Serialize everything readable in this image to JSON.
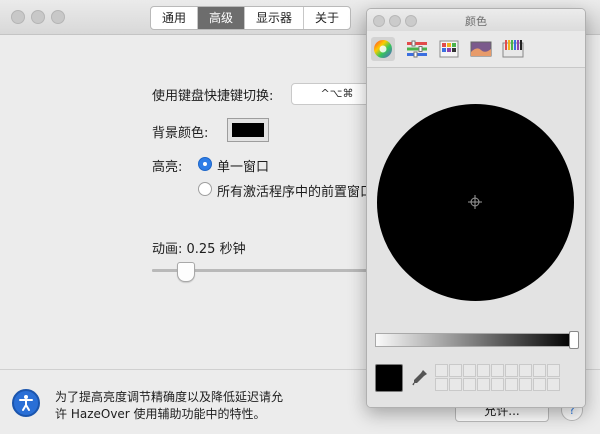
{
  "window": {
    "tabs": [
      {
        "label": "通用"
      },
      {
        "label": "高级"
      },
      {
        "label": "显示器"
      },
      {
        "label": "关于"
      }
    ],
    "active_tab": "高级"
  },
  "settings": {
    "shortcut_label": "使用键盘快捷键切换:",
    "shortcut_value": "^⌥⌘",
    "bg_color_label": "背景颜色:",
    "bg_color": "#000000",
    "highlight_label": "高亮:",
    "highlight_options": [
      {
        "label": "单一窗口",
        "selected": true
      },
      {
        "label": "所有激活程序中的前置窗口",
        "selected": false
      }
    ],
    "animation_label": "动画: 0.25 秒钟",
    "animation_level": 0.15
  },
  "footer": {
    "message_line1": "为了提高亮度调节精确度以及降低延迟请允",
    "message_line2": "许 HazeOver 使用辅助功能中的特性。",
    "allow_button": "允许...",
    "help_button": "?"
  },
  "color_panel": {
    "title": "颜色",
    "tools": [
      "color-wheel-icon",
      "sliders-icon",
      "palettes-icon",
      "image-palette-icon",
      "crayons-icon"
    ],
    "current_color": "#000000",
    "brightness": 0.0
  }
}
